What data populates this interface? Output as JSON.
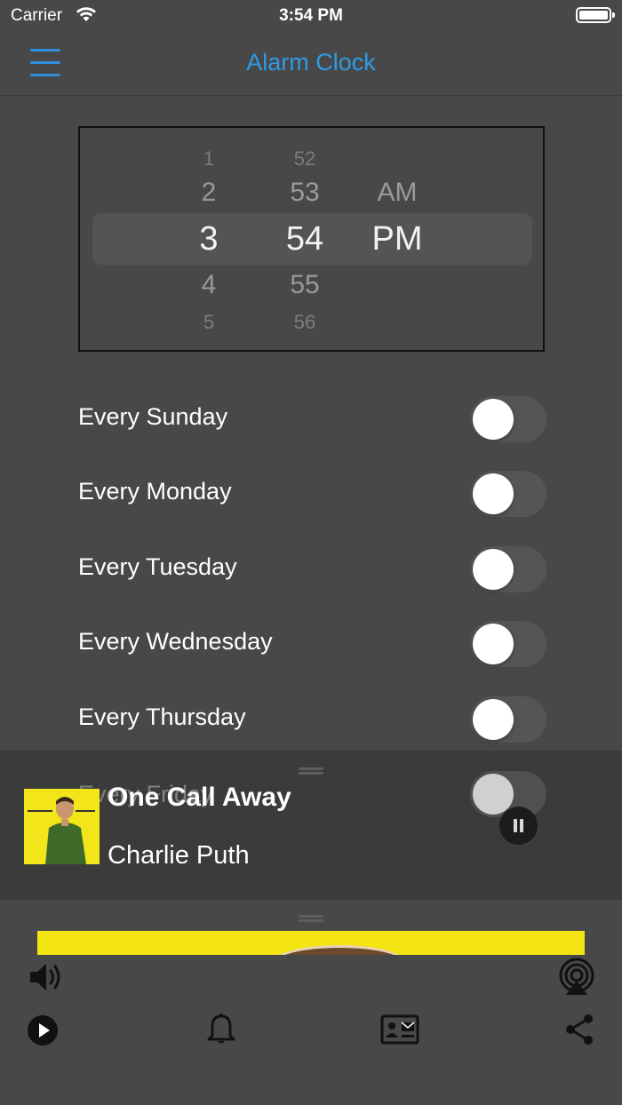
{
  "status_bar": {
    "carrier": "Carrier",
    "time": "3:54 PM"
  },
  "nav": {
    "title": "Alarm Clock",
    "menu_icon": "hamburger-menu-icon",
    "accent_color": "#2f9be6"
  },
  "time_picker": {
    "hours": [
      "1",
      "2",
      "3",
      "4",
      "5"
    ],
    "minutes": [
      "52",
      "53",
      "54",
      "55",
      "56"
    ],
    "periods": [
      "AM",
      "PM"
    ],
    "selected_hour": "3",
    "selected_minute": "54",
    "selected_period": "PM"
  },
  "days": [
    {
      "label": "Every Sunday",
      "on": false
    },
    {
      "label": "Every Monday",
      "on": false
    },
    {
      "label": "Every Tuesday",
      "on": false
    },
    {
      "label": "Every Wednesday",
      "on": false
    },
    {
      "label": "Every Thursday",
      "on": false
    },
    {
      "label": "Every Friday",
      "on": false
    }
  ],
  "now_playing": {
    "title": "One Call Away",
    "artist": "Charlie Puth",
    "state": "playing",
    "album_color": "#f2e51a"
  },
  "toolbar": {
    "icons": [
      "volume-icon",
      "airplay-icon",
      "play-icon",
      "bell-icon",
      "contact-card-icon",
      "share-icon"
    ]
  }
}
